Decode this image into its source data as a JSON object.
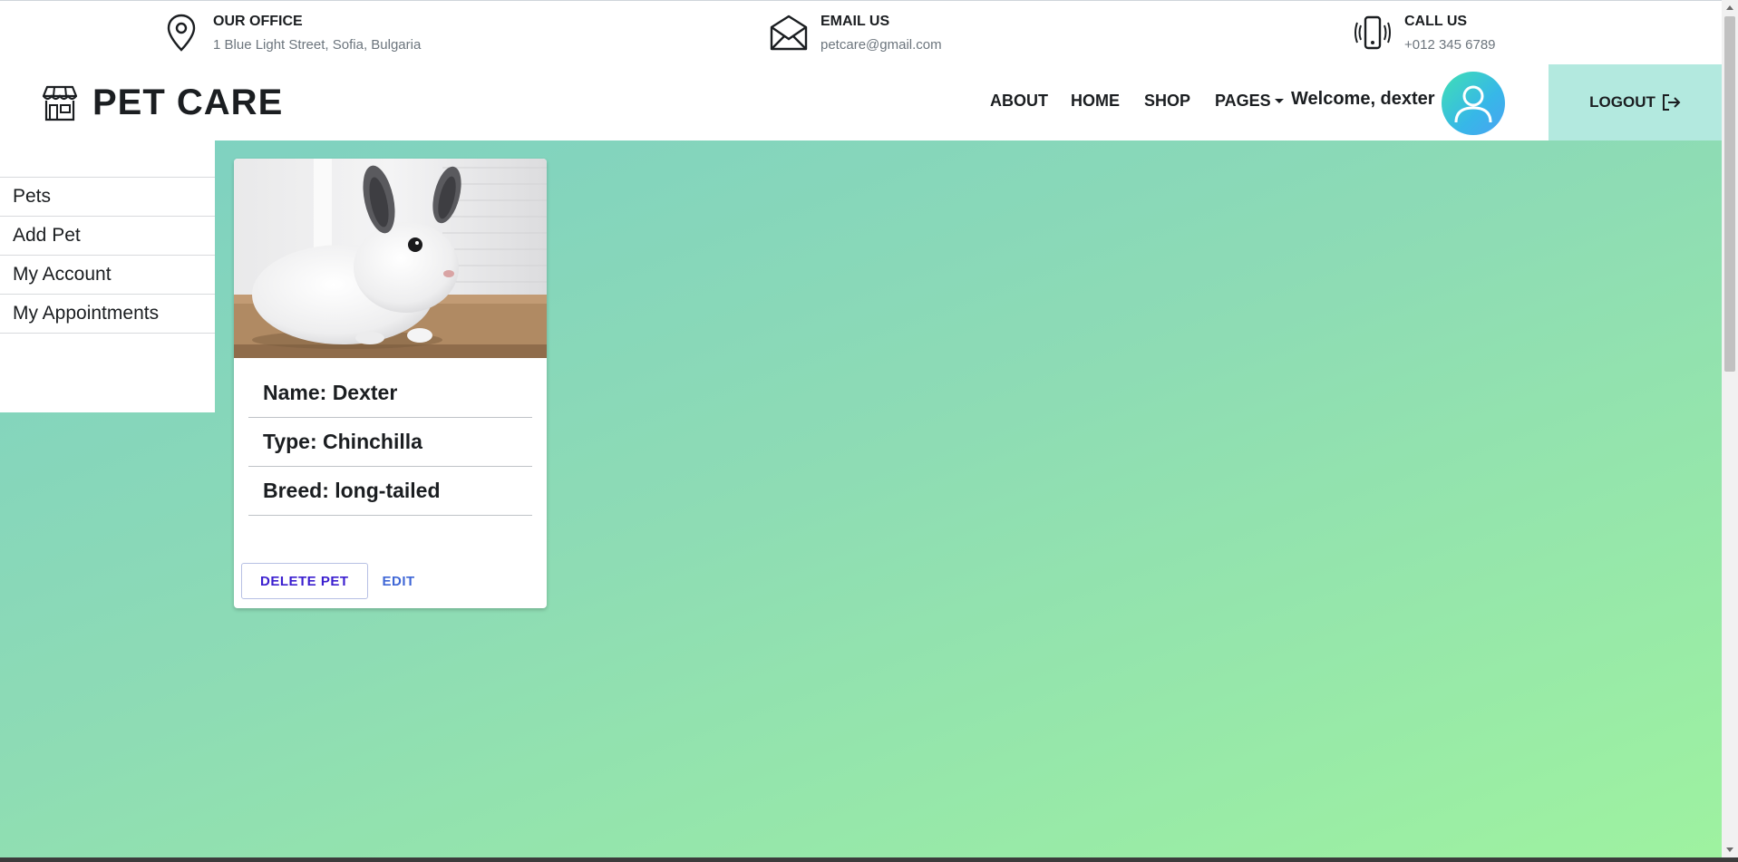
{
  "topbar": {
    "office": {
      "label": "OUR OFFICE",
      "value": "1 Blue Light Street, Sofia, Bulgaria",
      "icon": "location-pin-icon"
    },
    "email": {
      "label": "EMAIL US",
      "value": "petcare@gmail.com",
      "icon": "envelope-icon"
    },
    "call": {
      "label": "CALL US",
      "value": "+012 345 6789",
      "icon": "phone-icon"
    }
  },
  "navbar": {
    "brand": "PET CARE",
    "brand_icon": "storefront-icon",
    "links": {
      "about": "ABOUT",
      "home": "HOME",
      "shop": "SHOP",
      "pages": "PAGES"
    },
    "welcome": "Welcome, dexter",
    "logout": "LOGOUT"
  },
  "sidebar": {
    "items": [
      "Pets",
      "Add Pet",
      "My Account",
      "My Appointments"
    ]
  },
  "card": {
    "image": "chinchilla photo",
    "name": "Name: Dexter",
    "type": "Type: Chinchilla",
    "breed": "Breed: long-tailed",
    "delete_label": "DELETE PET",
    "edit_label": "EDIT"
  },
  "colors": {
    "gradient_start": "#7dd0c2",
    "gradient_end": "#9ef2a0",
    "logout_bg": "#b3e9df",
    "delete_text": "#3b1fcf",
    "edit_text": "#3f67d6"
  }
}
